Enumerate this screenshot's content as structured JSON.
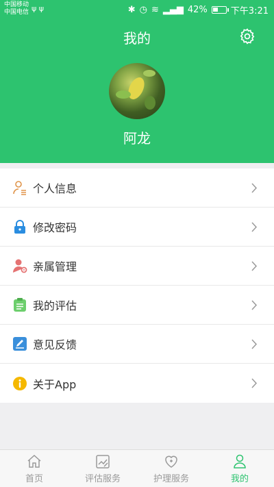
{
  "status_bar": {
    "carrier1": "中国移动",
    "carrier2": "中国电信",
    "battery": "42%",
    "battery_level": 0.42,
    "time": "下午3:21"
  },
  "header": {
    "title": "我的",
    "username": "阿龙"
  },
  "menu": [
    {
      "label": "个人信息",
      "icon": "user-info-icon",
      "color": "#e0944a"
    },
    {
      "label": "修改密码",
      "icon": "lock-icon",
      "color": "#2a8de0"
    },
    {
      "label": "亲属管理",
      "icon": "relatives-icon",
      "color": "#e57373"
    },
    {
      "label": "我的评估",
      "icon": "clipboard-icon",
      "color": "#6dcf6d"
    },
    {
      "label": "意见反馈",
      "icon": "feedback-pencil-icon",
      "color": "#3a8fdb"
    },
    {
      "label": "关于App",
      "icon": "info-icon",
      "color": "#f5b800"
    }
  ],
  "tabs": [
    {
      "label": "首页",
      "icon": "home-icon",
      "active": false
    },
    {
      "label": "评估服务",
      "icon": "assessment-icon",
      "active": false
    },
    {
      "label": "护理服务",
      "icon": "care-heart-icon",
      "active": false
    },
    {
      "label": "我的",
      "icon": "profile-icon",
      "active": true
    }
  ],
  "colors": {
    "brand": "#2dc36f",
    "tab_inactive": "#999999"
  }
}
